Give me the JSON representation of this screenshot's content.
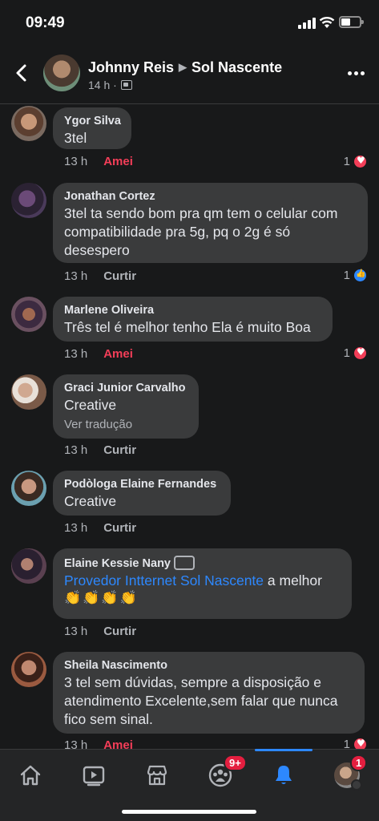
{
  "status_bar": {
    "time": "09:49"
  },
  "header": {
    "author": "Johnny Reis",
    "group": "Sol Nascente",
    "time": "14 h ·"
  },
  "comments": [
    {
      "author": "Ygor Silva",
      "text": "3tel",
      "time": "13 h",
      "action": "Amei",
      "reaction_count": "1",
      "reaction": "heart"
    },
    {
      "author": "Jonathan Cortez",
      "text": "3tel ta sendo bom pra qm tem o celular com compatibilidade pra 5g, pq o 2g é só desespero",
      "time": "13 h",
      "action": "Curtir",
      "reaction_count": "1",
      "reaction": "like"
    },
    {
      "author": "Marlene Oliveira",
      "text": "Três tel é melhor tenho Ela é muito Boa",
      "time": "13 h",
      "action": "Amei",
      "reaction_count": "1",
      "reaction": "heart"
    },
    {
      "author": "Graci Junior Carvalho",
      "text": "Creative",
      "translate": "Ver tradução",
      "time": "13 h",
      "action": "Curtir"
    },
    {
      "author": "Podòloga Elaine Fernandes",
      "text": "Creative",
      "time": "13 h",
      "action": "Curtir"
    },
    {
      "author": "Elaine Kessie Nany",
      "link": "Provedor Intternet Sol Nascente",
      "text_after_link": " a melhor",
      "emoji": "👏👏👏👏",
      "time": "13 h",
      "action": "Curtir"
    },
    {
      "author": "Sheila Nascimento",
      "text": "3 tel sem dúvidas, sempre a disposição e atendimento Excelente,sem falar que nunca fico sem sinal.",
      "time": "13 h",
      "action": "Amei",
      "reaction_count": "1",
      "reaction": "heart"
    }
  ],
  "tabbar": {
    "icons": [
      "home-icon",
      "watch-icon",
      "marketplace-icon",
      "groups-icon",
      "notifications-icon",
      "profile-menu"
    ],
    "groups_badge": "9+",
    "profile_badge": "1",
    "active": "notifications-icon"
  }
}
